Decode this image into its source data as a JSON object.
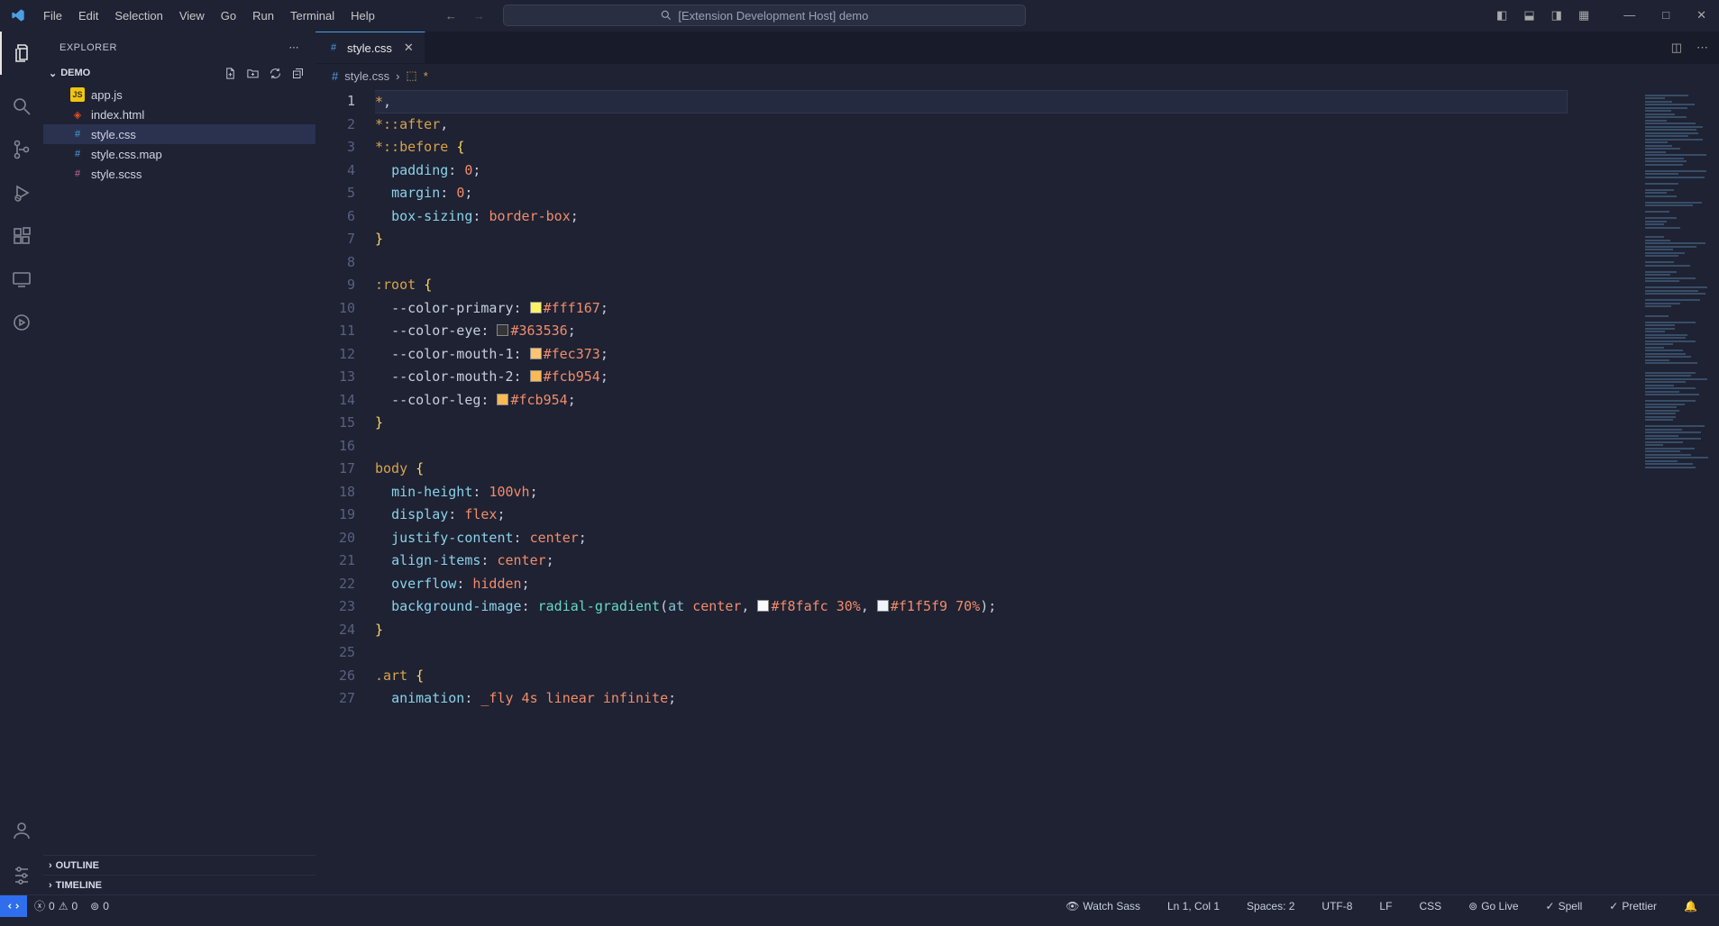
{
  "menu": [
    "File",
    "Edit",
    "Selection",
    "View",
    "Go",
    "Run",
    "Terminal",
    "Help"
  ],
  "searchCenter": "[Extension Development Host] demo",
  "explorer": {
    "title": "EXPLORER",
    "folderName": "DEMO",
    "files": [
      {
        "name": "app.js",
        "icon": "js"
      },
      {
        "name": "index.html",
        "icon": "html"
      },
      {
        "name": "style.css",
        "icon": "css",
        "active": true
      },
      {
        "name": "style.css.map",
        "icon": "css"
      },
      {
        "name": "style.scss",
        "icon": "scss"
      }
    ],
    "outline": "OUTLINE",
    "timeline": "TIMELINE"
  },
  "tab": {
    "label": "style.css"
  },
  "breadcrumb": {
    "file": "style.css",
    "sel": "*"
  },
  "code": {
    "lines": [
      {
        "n": 1,
        "current": true,
        "html": "<span class='tok-sel'>*</span><span class='tok-punct'>,</span>"
      },
      {
        "n": 2,
        "html": "<span class='tok-sel'>*</span><span class='tok-pseudo'>::after</span><span class='tok-punct'>,</span>"
      },
      {
        "n": 3,
        "html": "<span class='tok-sel'>*</span><span class='tok-pseudo'>::before</span> <span class='tok-brace'>{</span>"
      },
      {
        "n": 4,
        "html": "  <span class='tok-prop'>padding</span><span class='tok-punct'>:</span> <span class='tok-val'>0</span><span class='tok-punct'>;</span>"
      },
      {
        "n": 5,
        "html": "  <span class='tok-prop'>margin</span><span class='tok-punct'>:</span> <span class='tok-val'>0</span><span class='tok-punct'>;</span>"
      },
      {
        "n": 6,
        "html": "  <span class='tok-prop'>box-sizing</span><span class='tok-punct'>:</span> <span class='tok-val'>border-box</span><span class='tok-punct'>;</span>"
      },
      {
        "n": 7,
        "html": "<span class='tok-brace'>}</span>"
      },
      {
        "n": 8,
        "html": ""
      },
      {
        "n": 9,
        "html": "<span class='tok-pseudo'>:root</span> <span class='tok-brace'>{</span>"
      },
      {
        "n": 10,
        "html": "  <span class='tok-var'>--color-primary</span><span class='tok-punct'>:</span> <span class='color-swatch' style='background:#fff167'></span><span class='tok-val'>#fff167</span><span class='tok-punct'>;</span>"
      },
      {
        "n": 11,
        "html": "  <span class='tok-var'>--color-eye</span><span class='tok-punct'>:</span> <span class='color-swatch' style='background:#363536'></span><span class='tok-val'>#363536</span><span class='tok-punct'>;</span>"
      },
      {
        "n": 12,
        "html": "  <span class='tok-var'>--color-mouth-1</span><span class='tok-punct'>:</span> <span class='color-swatch' style='background:#fec373'></span><span class='tok-val'>#fec373</span><span class='tok-punct'>;</span>"
      },
      {
        "n": 13,
        "html": "  <span class='tok-var'>--color-mouth-2</span><span class='tok-punct'>:</span> <span class='color-swatch' style='background:#fcb954'></span><span class='tok-val'>#fcb954</span><span class='tok-punct'>;</span>"
      },
      {
        "n": 14,
        "html": "  <span class='tok-var'>--color-leg</span><span class='tok-punct'>:</span> <span class='color-swatch' style='background:#fcb954'></span><span class='tok-val'>#fcb954</span><span class='tok-punct'>;</span>"
      },
      {
        "n": 15,
        "html": "<span class='tok-brace'>}</span>"
      },
      {
        "n": 16,
        "html": ""
      },
      {
        "n": 17,
        "html": "<span class='tok-sel'>body</span> <span class='tok-brace'>{</span>"
      },
      {
        "n": 18,
        "html": "  <span class='tok-prop'>min-height</span><span class='tok-punct'>:</span> <span class='tok-val'>100vh</span><span class='tok-punct'>;</span>"
      },
      {
        "n": 19,
        "html": "  <span class='tok-prop'>display</span><span class='tok-punct'>:</span> <span class='tok-val'>flex</span><span class='tok-punct'>;</span>"
      },
      {
        "n": 20,
        "html": "  <span class='tok-prop'>justify-content</span><span class='tok-punct'>:</span> <span class='tok-val'>center</span><span class='tok-punct'>;</span>"
      },
      {
        "n": 21,
        "html": "  <span class='tok-prop'>align-items</span><span class='tok-punct'>:</span> <span class='tok-val'>center</span><span class='tok-punct'>;</span>"
      },
      {
        "n": 22,
        "html": "  <span class='tok-prop'>overflow</span><span class='tok-punct'>:</span> <span class='tok-val'>hidden</span><span class='tok-punct'>;</span>"
      },
      {
        "n": 23,
        "html": "  <span class='tok-prop'>background-image</span><span class='tok-punct'>:</span> <span class='tok-func'>radial-gradient</span><span class='tok-punct'>(</span><span class='tok-kw'>at</span> <span class='tok-val'>center</span><span class='tok-punct'>,</span> <span class='color-swatch' style='background:#f8fafc'></span><span class='tok-val'>#f8fafc</span> <span class='tok-val'>30%</span><span class='tok-punct'>,</span> <span class='color-swatch' style='background:#f1f5f9'></span><span class='tok-val'>#f1f5f9</span> <span class='tok-val'>70%</span><span class='tok-punct'>);</span>"
      },
      {
        "n": 24,
        "html": "<span class='tok-brace'>}</span>"
      },
      {
        "n": 25,
        "html": ""
      },
      {
        "n": 26,
        "html": "<span class='tok-sel'>.art</span> <span class='tok-brace'>{</span>"
      },
      {
        "n": 27,
        "html": "  <span class='tok-prop'>animation</span><span class='tok-punct'>:</span> <span class='tok-val'>_fly 4s linear infinite</span><span class='tok-punct'>;</span>"
      }
    ]
  },
  "status": {
    "errors": "0",
    "warnings": "0",
    "port": "0",
    "watchSass": "Watch Sass",
    "lnCol": "Ln 1, Col 1",
    "spaces": "Spaces: 2",
    "encoding": "UTF-8",
    "eol": "LF",
    "lang": "CSS",
    "goLive": "Go Live",
    "spell": "Spell",
    "prettier": "Prettier"
  }
}
